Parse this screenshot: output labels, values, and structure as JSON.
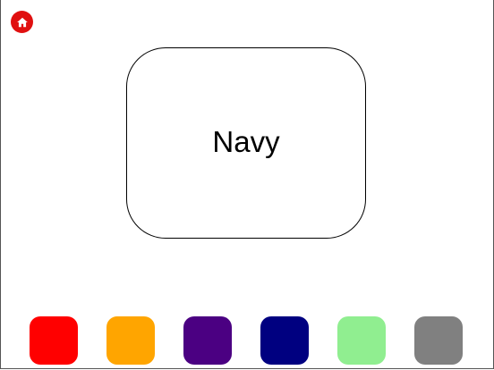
{
  "home": {
    "icon": "home-icon",
    "accent": "#e01010"
  },
  "card": {
    "word": "Navy"
  },
  "swatches": [
    {
      "color": "#ff0000"
    },
    {
      "color": "#ffa500"
    },
    {
      "color": "#4b0082"
    },
    {
      "color": "#000080"
    },
    {
      "color": "#90ee90"
    },
    {
      "color": "#808080"
    }
  ]
}
